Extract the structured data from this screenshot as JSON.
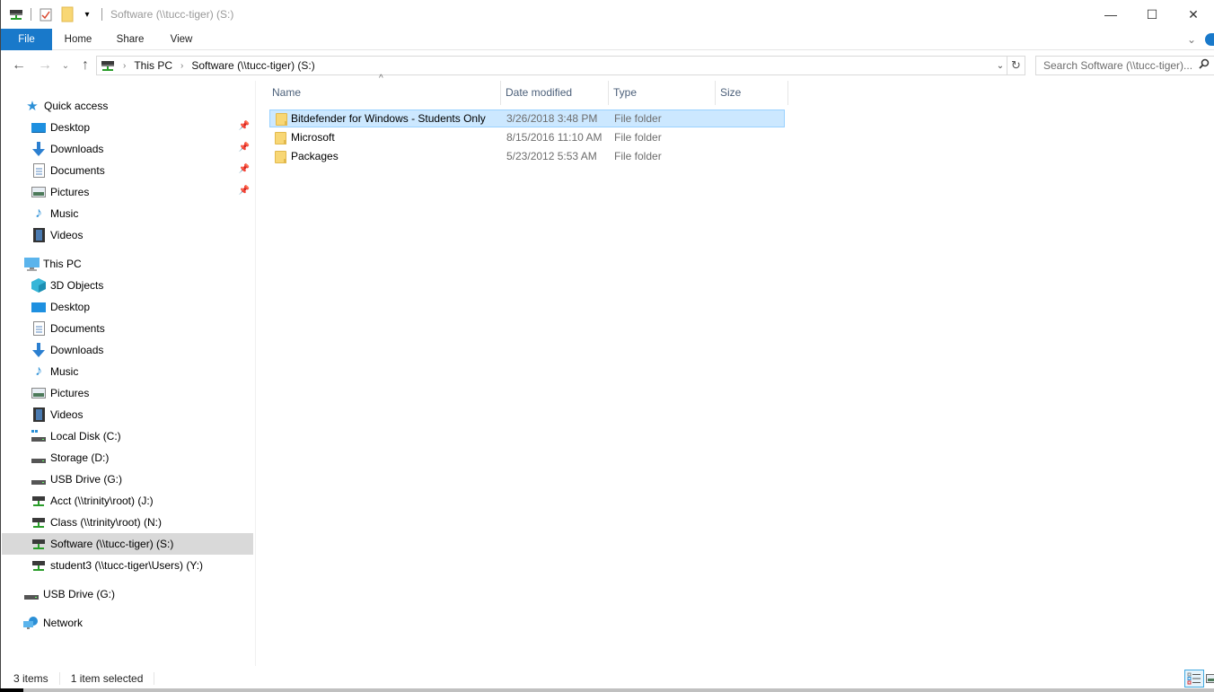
{
  "window": {
    "title": "Software (\\\\tucc-tiger) (S:)",
    "controls": {
      "minimize": "—",
      "maximize": "☐",
      "close": "✕"
    }
  },
  "ribbon": {
    "tabs": [
      {
        "label": "File",
        "active": true
      },
      {
        "label": "Home"
      },
      {
        "label": "Share"
      },
      {
        "label": "View"
      }
    ],
    "expand_icon": "⌄"
  },
  "nav": {
    "back": "←",
    "forward": "→",
    "recent": "⌄",
    "up": "↑",
    "breadcrumb": [
      "This PC",
      "Software (\\\\tucc-tiger) (S:)"
    ],
    "dropdown": "⌄",
    "refresh": "↻",
    "search_placeholder": "Search Software (\\\\tucc-tiger)...",
    "search_icon": "⚲"
  },
  "sidebar": {
    "quick_access": {
      "label": "Quick access",
      "items": [
        {
          "label": "Desktop",
          "icon": "desktop-icon",
          "pinned": true
        },
        {
          "label": "Downloads",
          "icon": "downloads-icon",
          "pinned": true
        },
        {
          "label": "Documents",
          "icon": "documents-icon",
          "pinned": true
        },
        {
          "label": "Pictures",
          "icon": "pictures-icon",
          "pinned": true
        },
        {
          "label": "Music",
          "icon": "music-icon",
          "pinned": false
        },
        {
          "label": "Videos",
          "icon": "videos-icon",
          "pinned": false
        }
      ]
    },
    "this_pc": {
      "label": "This PC",
      "items": [
        {
          "label": "3D Objects",
          "icon": "3d-objects-icon"
        },
        {
          "label": "Desktop",
          "icon": "desktop-icon"
        },
        {
          "label": "Documents",
          "icon": "documents-icon"
        },
        {
          "label": "Downloads",
          "icon": "downloads-icon"
        },
        {
          "label": "Music",
          "icon": "music-icon"
        },
        {
          "label": "Pictures",
          "icon": "pictures-icon"
        },
        {
          "label": "Videos",
          "icon": "videos-icon"
        },
        {
          "label": "Local Disk (C:)",
          "icon": "local-disk-icon"
        },
        {
          "label": "Storage (D:)",
          "icon": "drive-icon"
        },
        {
          "label": "USB Drive (G:)",
          "icon": "drive-icon"
        },
        {
          "label": "Acct (\\\\trinity\\root) (J:)",
          "icon": "network-drive-icon"
        },
        {
          "label": "Class (\\\\trinity\\root) (N:)",
          "icon": "network-drive-icon"
        },
        {
          "label": "Software (\\\\tucc-tiger) (S:)",
          "icon": "network-drive-icon",
          "selected": true
        },
        {
          "label": "student3 (\\\\tucc-tiger\\Users) (Y:)",
          "icon": "network-drive-icon"
        }
      ]
    },
    "usb_drive": {
      "label": "USB Drive (G:)"
    },
    "network": {
      "label": "Network"
    }
  },
  "filelist": {
    "columns": [
      "Name",
      "Date modified",
      "Type",
      "Size"
    ],
    "rows": [
      {
        "name": "Bitdefender for Windows - Students Only",
        "date": "3/26/2018 3:48 PM",
        "type": "File folder",
        "size": "",
        "selected": true
      },
      {
        "name": "Microsoft",
        "date": "8/15/2016 11:10 AM",
        "type": "File folder",
        "size": ""
      },
      {
        "name": "Packages",
        "date": "5/23/2012 5:53 AM",
        "type": "File folder",
        "size": ""
      }
    ]
  },
  "status": {
    "item_count": "3 items",
    "selection": "1 item selected"
  },
  "colors": {
    "accent": "#1979ca",
    "selection_bg": "#cce8ff",
    "selection_border": "#99d1ff",
    "nav_selected": "#d9d9d9",
    "header_text": "#4c607a"
  }
}
